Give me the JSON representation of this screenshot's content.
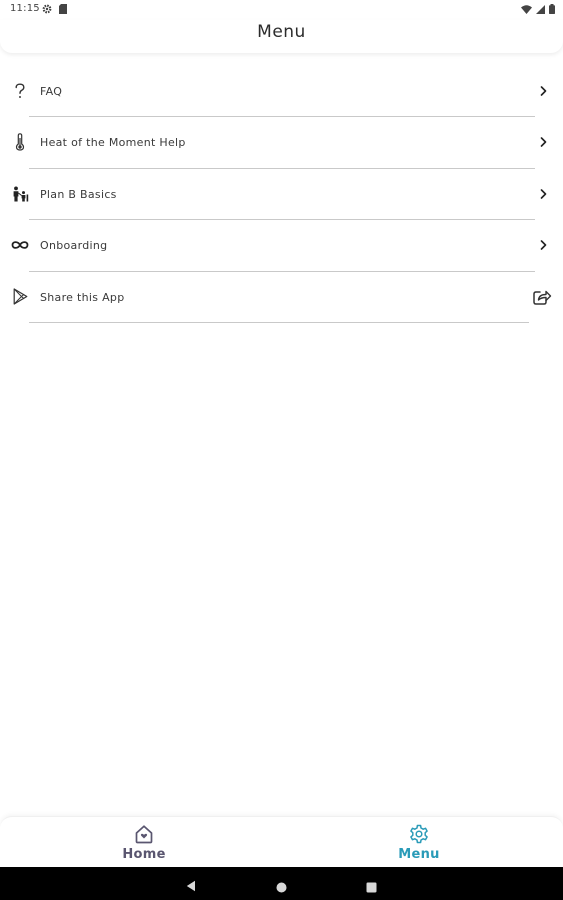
{
  "status_bar": {
    "time": "11:15",
    "left_icons": [
      "gear-icon",
      "sd-card-icon"
    ],
    "right_icons": [
      "wifi-icon",
      "signal-icon",
      "battery-icon"
    ]
  },
  "app_bar": {
    "title": "Menu"
  },
  "menu": {
    "items": [
      {
        "label": "FAQ",
        "icon": "question-icon",
        "trailing": "chevron-right-icon"
      },
      {
        "label": "Heat of the Moment Help",
        "icon": "thermometer-icon",
        "trailing": "chevron-right-icon"
      },
      {
        "label": "Plan B Basics",
        "icon": "family-icon",
        "trailing": "chevron-right-icon"
      },
      {
        "label": "Onboarding",
        "icon": "infinity-icon",
        "trailing": "chevron-right-icon"
      },
      {
        "label": "Share this App",
        "icon": "play-store-icon",
        "trailing": "share-icon"
      }
    ]
  },
  "bottom_nav": {
    "tabs": [
      {
        "label": "Home",
        "icon": "home-icon",
        "active": false
      },
      {
        "label": "Menu",
        "icon": "gear-icon",
        "active": true
      }
    ],
    "active_color": "#2a9bb8",
    "inactive_color": "#5a5670"
  },
  "system_nav": {
    "buttons": [
      "back-icon",
      "home-circle-icon",
      "recents-icon"
    ]
  }
}
